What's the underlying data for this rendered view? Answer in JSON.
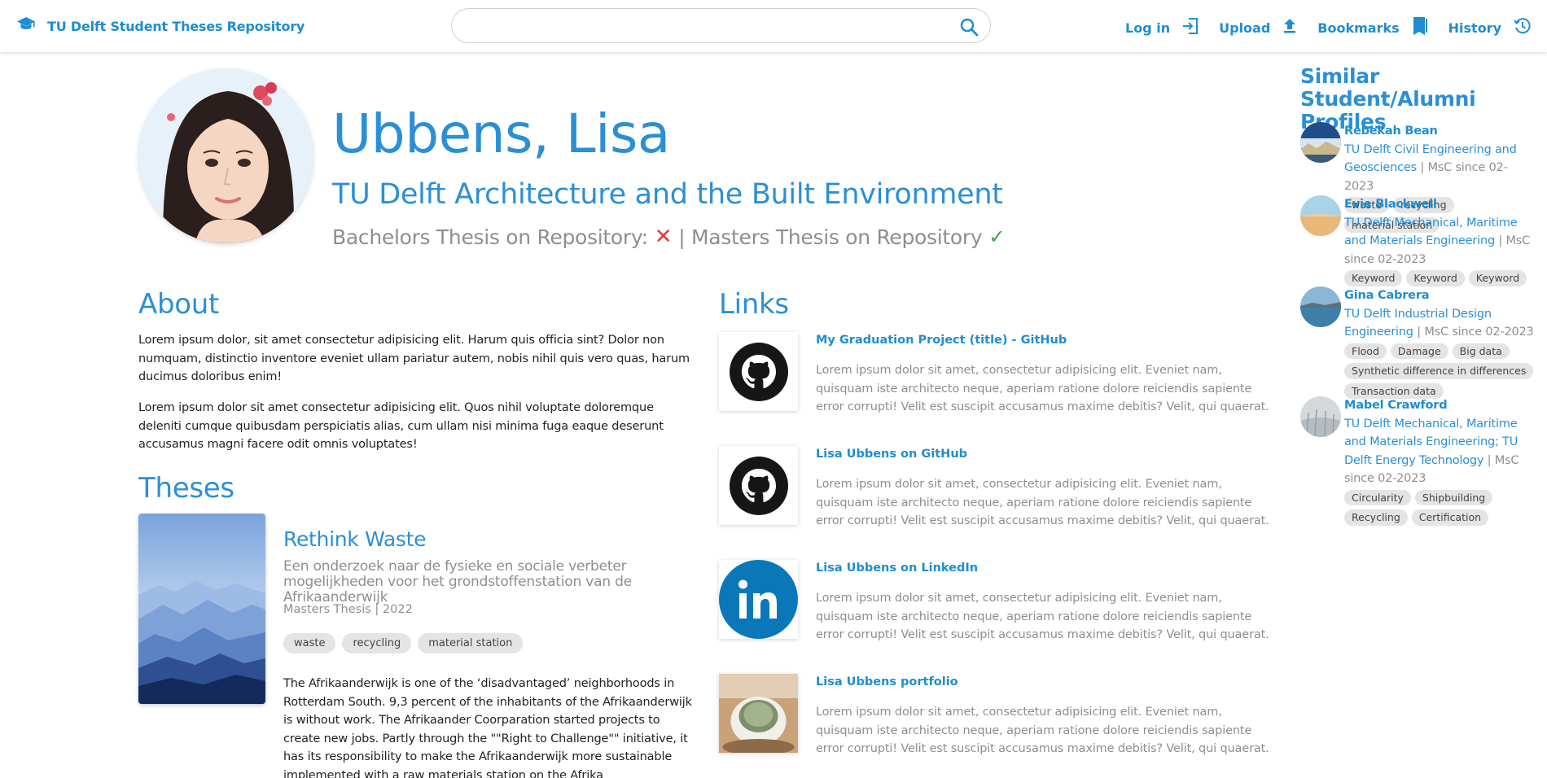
{
  "header": {
    "brand": "TU Delft Student Theses Repository",
    "search_placeholder": "",
    "nav": {
      "login": "Log in",
      "upload": "Upload",
      "bookmarks": "Bookmarks",
      "history": "History"
    }
  },
  "profile": {
    "name": "Ubbens, Lisa",
    "faculty": "TU Delft Architecture and the Built Environment",
    "bachelors_label": "Bachelors Thesis on Repository:",
    "masters_label": "| Masters Thesis on Repository",
    "bachelors_on_repo": false,
    "masters_on_repo": true
  },
  "about": {
    "heading": "About",
    "paragraphs": [
      "Lorem ipsum dolor, sit amet consectetur adipisicing elit. Harum quis officia sint? Dolor non numquam, distinctio inventore eveniet ullam pariatur autem, nobis nihil quis vero quas, harum ducimus doloribus enim!",
      "Lorem ipsum dolor sit amet consectetur adipisicing elit. Quos nihil voluptate doloremque deleniti cumque quibusdam perspiciatis alias, cum ullam nisi minima fuga eaque deserunt accusamus magni facere odit omnis voluptates!"
    ]
  },
  "theses": {
    "heading": "Theses",
    "items": [
      {
        "title": "Rethink Waste",
        "subtitle": "Een onderzoek naar de fysieke en sociale verbeter mogelijkheden voor het grondstoffenstation van de Afrikaanderwijk",
        "meta": "Masters Thesis | 2022",
        "tags": [
          "waste",
          "recycling",
          "material station"
        ],
        "body": "The Afrikaanderwijk is one of the ‘disadvantaged’ neighborhoods in Rotterdam South. 9,3 percent of the inhabitants of the Afrikaanderwijk is without work. The Afrikaander Coorparation started projects to create new jobs. Partly through the \"\"Right to Challenge\"\" initiative, it has its responsibility to make the Afrikaanderwijk more sustainable implemented with a raw materials station on the Afrika"
      }
    ]
  },
  "links": {
    "heading": "Links",
    "items": [
      {
        "title": "My Graduation Project (title) - GitHub",
        "icon": "github-icon",
        "desc": "Lorem ipsum dolor sit amet, consectetur adipisicing elit. Eveniet nam, quisquam iste architecto neque, aperiam ratione dolore reiciendis sapiente error corrupti! Velit est suscipit accusamus maxime debitis? Velit, qui quaerat."
      },
      {
        "title": "Lisa Ubbens on GitHub",
        "icon": "github-icon",
        "desc": "Lorem ipsum dolor sit amet, consectetur adipisicing elit. Eveniet nam, quisquam iste architecto neque, aperiam ratione dolore reiciendis sapiente error corrupti! Velit est suscipit accusamus maxime debitis? Velit, qui quaerat."
      },
      {
        "title": "Lisa Ubbens on LinkedIn",
        "icon": "linkedin-icon",
        "desc": "Lorem ipsum dolor sit amet, consectetur adipisicing elit. Eveniet nam, quisquam iste architecto neque, aperiam ratione dolore reiciendis sapiente error corrupti! Velit est suscipit accusamus maxime debitis? Velit, qui quaerat."
      },
      {
        "title": "Lisa Ubbens portfolio",
        "icon": "portfolio-image",
        "desc": "Lorem ipsum dolor sit amet, consectetur adipisicing elit. Eveniet nam, quisquam iste architecto neque, aperiam ratione dolore reiciendis sapiente error corrupti! Velit est suscipit accusamus maxime debitis? Velit, qui quaerat."
      }
    ]
  },
  "similar": {
    "heading": "Similar Student/Alumni Profiles",
    "people": [
      {
        "name": "Rebekah Bean",
        "faculty": "TU Delft Civil Engineering and Geosciences",
        "status": " | MsC since 02-2023",
        "tags": [
          "waste",
          "recycling",
          "material station"
        ]
      },
      {
        "name": "Evie Blackwell",
        "faculty": "TU Delft Mechanical, Maritime and Materials Engineering",
        "status": " | MsC since 02-2023",
        "tags": [
          "Keyword",
          "Keyword",
          "Keyword"
        ]
      },
      {
        "name": "Gina Cabrera",
        "faculty": "TU Delft Industrial Design Engineering",
        "status": " | MsC since 02-2023",
        "tags": [
          "Flood",
          "Damage",
          "Big data",
          "Synthetic difference in differences",
          "Transaction data"
        ]
      },
      {
        "name": "Mabel Crawford",
        "faculty": "TU Delft Mechanical, Maritime and Materials Engineering; TU Delft Energy Technology",
        "status": " | MsC since 02-2023",
        "tags": [
          "Circularity",
          "Shipbuilding",
          "Recycling",
          "Certification"
        ]
      }
    ]
  },
  "colors": {
    "accent": "#2b8fd6",
    "link": "#1f8dcf",
    "muted": "#8e8e8e",
    "tag_bg": "#e4e4e4",
    "cross": "#e53935",
    "check": "#43a047"
  }
}
